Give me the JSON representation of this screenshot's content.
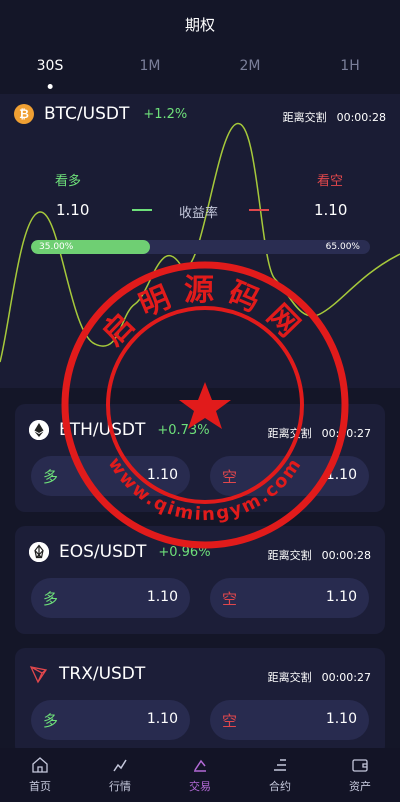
{
  "header": {
    "title": "期权"
  },
  "tabs": [
    {
      "label": "30S",
      "active": true
    },
    {
      "label": "1M",
      "active": false
    },
    {
      "label": "2M",
      "active": false
    },
    {
      "label": "1H",
      "active": false
    }
  ],
  "main": {
    "symbol": "BTC/USDT",
    "change": "+1.2%",
    "countdown_label": "距离交割",
    "countdown": "00:00:28",
    "bull_label": "看多",
    "bear_label": "看空",
    "bull_odds": "1.10",
    "bear_odds": "1.10",
    "rate_label": "收益率",
    "bull_percent": "35.00%",
    "bear_percent": "65.00%",
    "bull_fraction": 0.35
  },
  "cards": [
    {
      "symbol": "ETH/USDT",
      "change": "+0.73%",
      "countdown_label": "距离交割",
      "countdown": "00:00:27",
      "long_label": "多",
      "long_value": "1.10",
      "short_label": "空",
      "short_value": "1.10"
    },
    {
      "symbol": "EOS/USDT",
      "change": "+0.96%",
      "countdown_label": "距离交割",
      "countdown": "00:00:28",
      "long_label": "多",
      "long_value": "1.10",
      "short_label": "空",
      "short_value": "1.10"
    },
    {
      "symbol": "TRX/USDT",
      "change": "",
      "countdown_label": "距离交割",
      "countdown": "00:00:27",
      "long_label": "多",
      "long_value": "1.10",
      "short_label": "空",
      "short_value": "1.10"
    }
  ],
  "nav": [
    {
      "label": "首页",
      "icon": "home-icon",
      "active": false
    },
    {
      "label": "行情",
      "icon": "market-icon",
      "active": false
    },
    {
      "label": "交易",
      "icon": "trade-icon",
      "active": true
    },
    {
      "label": "合约",
      "icon": "contract-icon",
      "active": false
    },
    {
      "label": "资产",
      "icon": "wallet-icon",
      "active": false
    }
  ],
  "watermark": {
    "text": "启明源码网",
    "url": "www.qimingym.com"
  },
  "colors": {
    "bg": "#141628",
    "panel": "#1a1c34",
    "card": "#1c1e38",
    "button": "#282b4f",
    "green": "#6ee07a",
    "red": "#e0474c",
    "purple": "#b36ad6",
    "watermark": "#e11b1b"
  }
}
